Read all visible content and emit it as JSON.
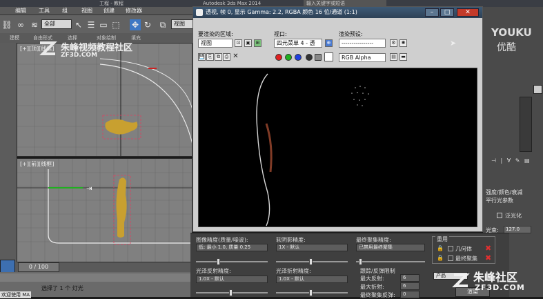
{
  "topbar": {
    "tabs": [
      "",
      "工程 - 教程",
      "Autodesk 3ds Max 2014",
      "输入关键字或短语"
    ]
  },
  "menu": {
    "items": [
      "编辑",
      "工具",
      "组",
      "视图",
      "创建",
      "修改器"
    ]
  },
  "toolbar": {
    "selection_filter": "全部",
    "view_select": "视图"
  },
  "cmdtabs": [
    "建模",
    "自由形式",
    "选择",
    "对象绘制",
    "填充"
  ],
  "watermark": {
    "title": "朱峰视频教程社区",
    "domain": "ZF3D.COM"
  },
  "viewports": {
    "top_label": "[+][顶][线框]",
    "front_label": "[+][前][线框]"
  },
  "dialog": {
    "title": "透视, 帧 0, 显示 Gamma: 2.2, RGBA 颜色 16 位/通道 (1:1)",
    "area_label": "要渲染的区域:",
    "area_value": "视图",
    "viewport_label": "视口:",
    "viewport_value": "四元菜单 4 - 透",
    "preset_label": "渲染预设:",
    "preset_value": "----------------",
    "channel_value": "RGB Alpha",
    "colors": {
      "red": "#e02020",
      "green": "#20b020",
      "blue": "#2040e0",
      "white": "#ffffff"
    }
  },
  "settings": {
    "image_precision_label": "图像精度(质量/噪波):",
    "image_precision_value": "低: 最小 1.0, 质量 0.25",
    "soft_shadow_label": "软阴影精度:",
    "soft_shadow_value": "1X - 默认",
    "final_gather_label": "最终聚集精度:",
    "final_gather_value": "已禁用最终聚集",
    "glossy_reflect_label": "光泽反射精度:",
    "glossy_reflect_value": "1.0X - 默认",
    "glossy_refract_label": "光泽折射精度:",
    "glossy_refract_value": "1.0X - 默认",
    "trace_label": "跟踪/反弹限制",
    "max_reflect_label": "最大反射:",
    "max_reflect_value": "6",
    "max_refract_label": "最大折射:",
    "max_refract_value": "6",
    "fg_bounce_label": "最终聚集反弹:",
    "fg_bounce_value": "0",
    "reuse_label": "重用",
    "geometry_label": "几何体",
    "final_gather_check": "最终聚集",
    "product_label": "产品",
    "render_button": "渲染"
  },
  "right_panel": {
    "youku": "YOUKU",
    "youku_cn": "优酷",
    "light_color_label": "强度/颜色/衰减",
    "parallel_label": "平行光参数",
    "overshoot_label": "泛光化",
    "hotspot_label": "光束:",
    "hotspot_value": "127.0",
    "watermark_cn": "朱峰社区",
    "watermark_en": "ZF3D.COM"
  },
  "timeline": {
    "frame": "0 / 100"
  },
  "status": {
    "message": "选择了 1 个 灯光",
    "left_text": "欢迎使用 MA"
  }
}
